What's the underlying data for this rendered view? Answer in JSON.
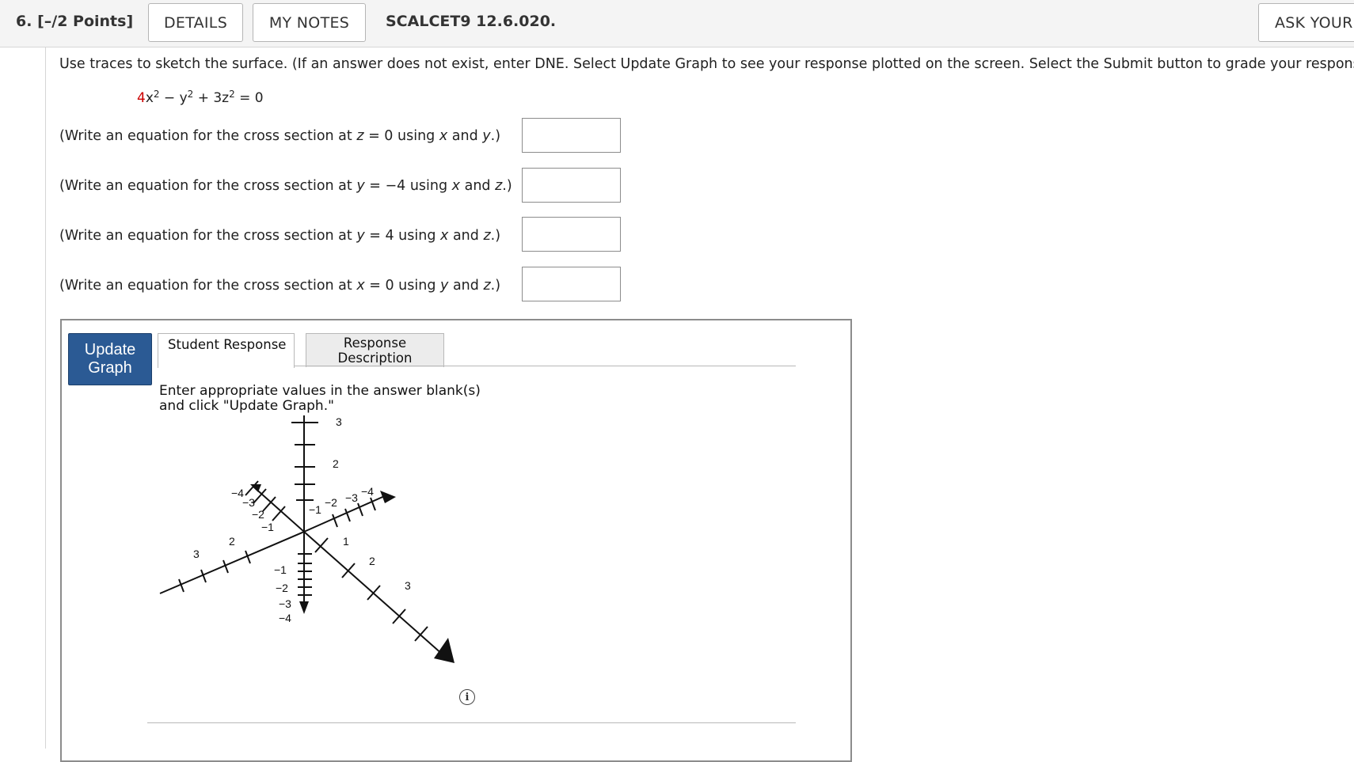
{
  "header": {
    "question_number": "6.",
    "points": "[–/2 Points]",
    "details_label": "DETAILS",
    "notes_label": "MY NOTES",
    "assignment_code": "SCALCET9 12.6.020.",
    "ask_label": "ASK YOUR"
  },
  "question": {
    "instructions": "Use traces to sketch the surface. (If an answer does not exist, enter DNE. Select Update Graph to see your response plotted on the screen. Select the Submit button to grade your response.)",
    "equation": {
      "coef_x": "4",
      "x_term": "x",
      "rest_a": " − ",
      "y_term": "y",
      "rest_b": " + 3",
      "z_term": "z",
      "rest_c": " = 0",
      "exp": "2"
    },
    "prompts": [
      {
        "pre": "(Write an equation for the cross section at ",
        "var": "z",
        "eq": " = 0 using ",
        "v1": "x",
        "and": " and ",
        "v2": "y",
        "post": ".)",
        "value": ""
      },
      {
        "pre": "(Write an equation for the cross section at ",
        "var": "y",
        "eq": " = −4 using ",
        "v1": "x",
        "and": " and ",
        "v2": "z",
        "post": ".)",
        "value": ""
      },
      {
        "pre": "(Write an equation for the cross section at ",
        "var": "y",
        "eq": " = 4 using ",
        "v1": "x",
        "and": " and ",
        "v2": "z",
        "post": ".)",
        "value": ""
      },
      {
        "pre": "(Write an equation for the cross section at ",
        "var": "x",
        "eq": " = 0 using ",
        "v1": "y",
        "and": " and ",
        "v2": "z",
        "post": ".)",
        "value": ""
      }
    ]
  },
  "graph": {
    "update_label_1": "Update",
    "update_label_2": "Graph",
    "tab_student": "Student Response",
    "tab_desc_1": "Response",
    "tab_desc_2": "Description",
    "message_1": "Enter appropriate values in the answer blank(s)",
    "message_2": "and click \"Update Graph.\"",
    "info_glyph": "i",
    "accent_color": "#2b5a94",
    "axis_labels": {
      "z_up_3": "3",
      "z_up_2": "2",
      "z_down_1": "−1",
      "z_down_2": "−2",
      "z_down_3": "−3",
      "z_down_4": "−4",
      "x_pos_1": "1",
      "x_pos_2": "2",
      "x_pos_3": "3",
      "x_neg_1": "−1",
      "x_neg_2": "−2",
      "x_neg_3": "−3",
      "x_neg_4": "−4",
      "y_pos_2": "2",
      "y_pos_3": "3",
      "y_neg_1": "−1",
      "y_neg_2": "−2",
      "y_neg_3": "−3",
      "y_neg_4": "−4"
    }
  }
}
